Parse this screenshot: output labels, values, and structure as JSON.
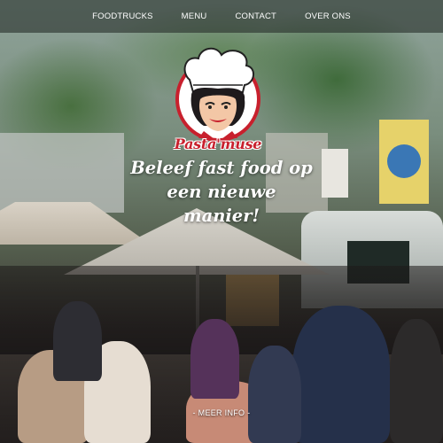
{
  "nav": {
    "items": [
      {
        "label": "FOODTRUCKS"
      },
      {
        "label": "MENU"
      },
      {
        "label": "CONTACT"
      },
      {
        "label": "OVER ONS"
      }
    ]
  },
  "brand": {
    "wordmark": "Pasta'muse",
    "logo_icon": "chef-woman-logo-icon",
    "brand_color": "#c8202d"
  },
  "hero": {
    "tagline_line1": "Beleef fast food op",
    "tagline_line2": "een nieuwe",
    "tagline_line3": "manier!",
    "more_info": "- MEER INFO -"
  },
  "colors": {
    "nav_background": "rgba(40,48,44,0.62)",
    "text": "#ffffff"
  }
}
